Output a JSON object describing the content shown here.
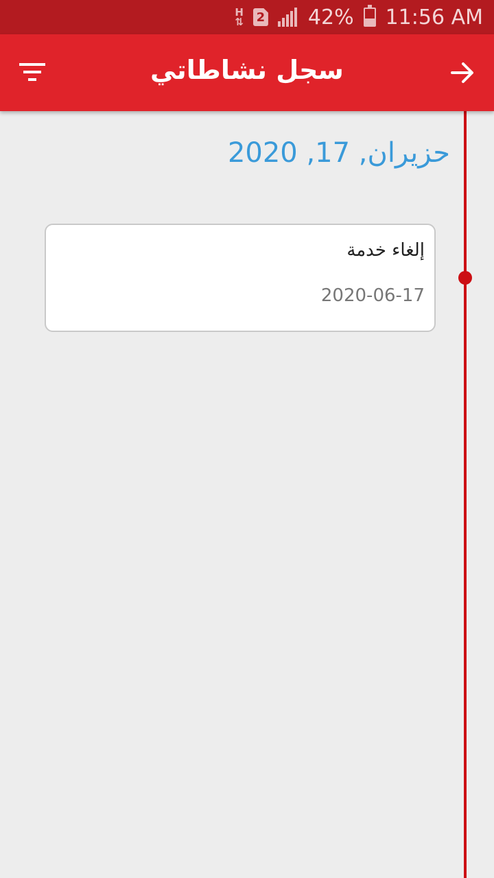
{
  "status_bar": {
    "network_type": "H",
    "sim_slot": "2",
    "battery_percent": "42%",
    "battery_level": 0.42,
    "time": "11:56 AM",
    "icons": [
      "h-network-icon",
      "sim-2-icon",
      "signal-icon",
      "battery-icon"
    ]
  },
  "app_bar": {
    "title": "سجل نشاطاتي",
    "left_icon": "filter-icon",
    "right_icon": "arrow-forward-icon",
    "color": "#e0232a"
  },
  "timeline": {
    "color": "#cc0f14",
    "groups": [
      {
        "date_heading": "حزيران, 17, 2020",
        "items": [
          {
            "title": "إلغاء خدمة",
            "date": "2020-06-17"
          }
        ]
      }
    ]
  },
  "colors": {
    "status_bar": "#b31b20",
    "background": "#ededed",
    "date_heading": "#3a9ad9"
  }
}
